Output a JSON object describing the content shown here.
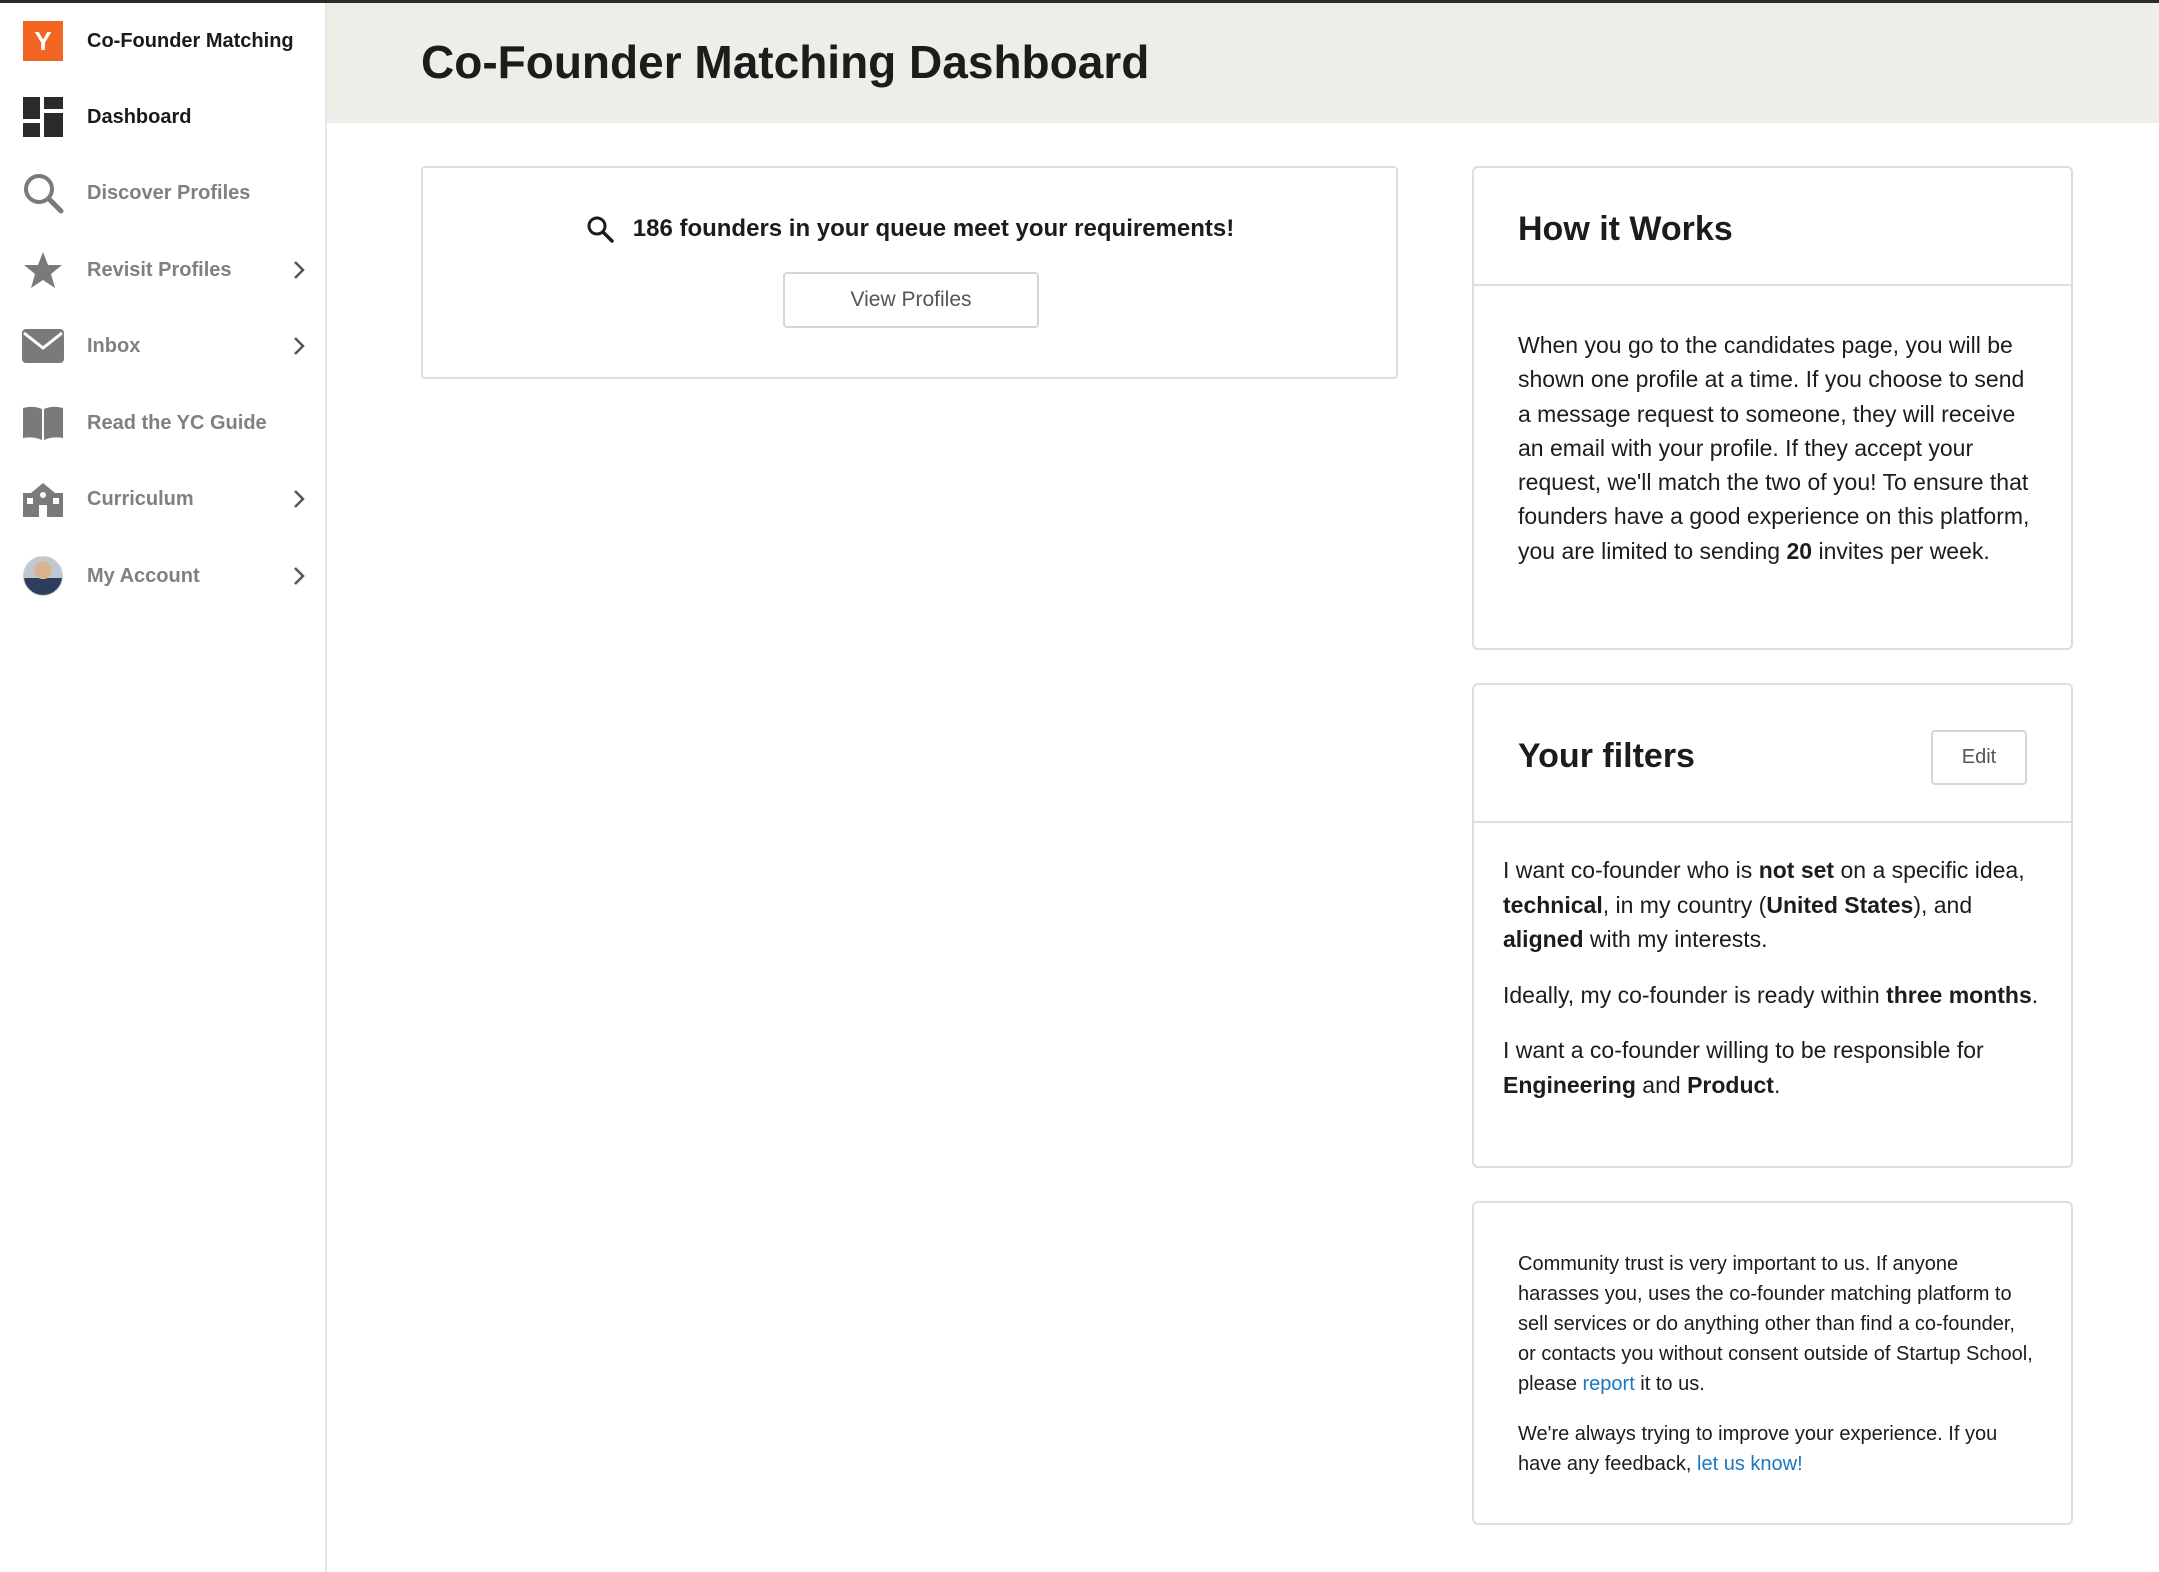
{
  "sidebar": {
    "app_name": "Co-Founder Matching",
    "logo_letter": "Y",
    "items": [
      {
        "label": "Dashboard",
        "icon": "dashboard-icon"
      },
      {
        "label": "Discover Profiles",
        "icon": "search-icon"
      },
      {
        "label": "Revisit Profiles",
        "icon": "star-icon"
      },
      {
        "label": "Inbox",
        "icon": "mail-icon"
      },
      {
        "label": "Read the YC Guide",
        "icon": "book-icon"
      },
      {
        "label": "Curriculum",
        "icon": "school-icon"
      },
      {
        "label": "My Account",
        "icon": "avatar"
      }
    ]
  },
  "header": {
    "title": "Co-Founder Matching Dashboard"
  },
  "queue": {
    "message": "186 founders in your queue meet your requirements!",
    "button_label": "View Profiles"
  },
  "how_it_works": {
    "title": "How it Works",
    "text_before": "When you go to the candidates page, you will be shown one profile at a time. If you choose to send a message request to someone, they will receive an email with your profile. If they accept your request, we'll match the two of you! To ensure that founders have a good experience on this platform, you are limited to sending ",
    "limit": "20",
    "text_after": " invites per week."
  },
  "filters": {
    "title": "Your filters",
    "edit_label": "Edit",
    "p1": {
      "t1": "I want co-founder who is ",
      "idea": "not set",
      "t2": " on a specific idea, ",
      "technical": "technical",
      "t3": ", in my country (",
      "country": "United States",
      "t4": "), and ",
      "interests": "aligned",
      "t5": " with my interests."
    },
    "p2": {
      "t1": "Ideally, my co-founder is ready within ",
      "timing": "three months",
      "t2": "."
    },
    "p3": {
      "t1": "I want a co-founder willing to be responsible for ",
      "area1": "Engineering",
      "t2": " and ",
      "area2": "Product",
      "t3": "."
    }
  },
  "trust": {
    "p1_before": "Community trust is very important to us. If anyone harasses you, uses the co-founder matching platform to sell services or do anything other than find a co-founder, or contacts you without consent outside of Startup School, please ",
    "report_link": "report",
    "p1_after": " it to us.",
    "p2_before": "We're always trying to improve your experience. If you have any feedback, ",
    "feedback_link": "let us know!"
  },
  "colors": {
    "accent": "#f26522",
    "header_bg": "#eeede7",
    "link": "#1a78c2"
  }
}
